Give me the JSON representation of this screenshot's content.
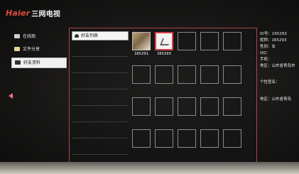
{
  "app": {
    "brand_logo": "Haier",
    "brand_name": "三网电视"
  },
  "sidebar": {
    "items": [
      {
        "label": "在线观",
        "icon": "monitor-icon",
        "active": false
      },
      {
        "label": "文件分享",
        "icon": "folder-icon",
        "active": false
      },
      {
        "label": "好友资料",
        "icon": "heart-icon",
        "active": true
      }
    ]
  },
  "categories": {
    "active_label": "好友列表",
    "items": [
      "好友列表",
      "",
      "",
      "",
      "",
      "",
      "",
      "",
      ""
    ]
  },
  "friends": [
    {
      "id": "165291",
      "type": "photo"
    },
    {
      "id": "165293",
      "type": "selected"
    },
    {
      "id": "",
      "type": "empty"
    }
  ],
  "profile": {
    "rows": [
      "ID号：165293",
      "昵称：165293",
      "性别：女",
      "QQ：",
      "手机：",
      "地区：山东省青岛市"
    ],
    "signature_label": "个性签名：",
    "location_label": "地区：山东省青岛"
  },
  "colors": {
    "accent_red": "#d8414b",
    "panel_border": "#a8484c",
    "brand_red": "#e34b3c",
    "nav_arrow": "#f26a86"
  }
}
